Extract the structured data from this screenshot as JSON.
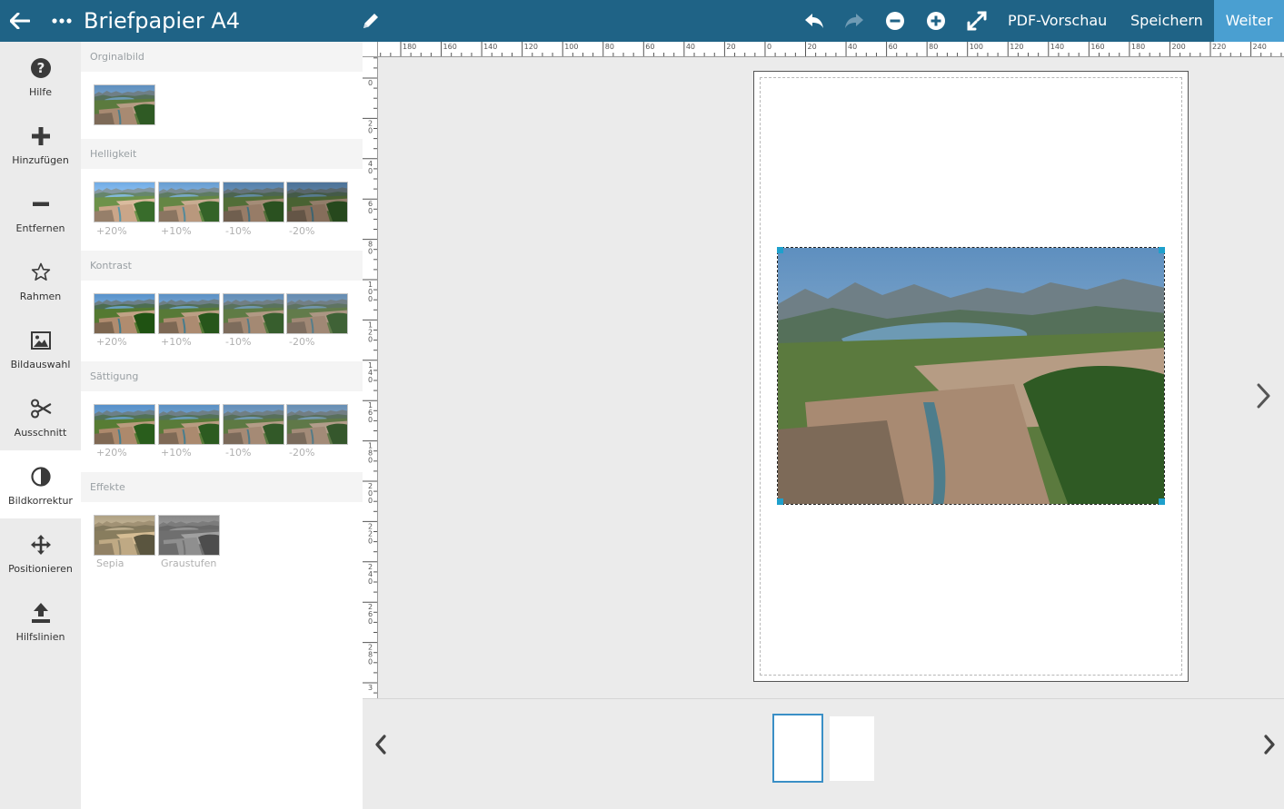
{
  "header": {
    "title": "Briefpapier A4",
    "pdf_preview_label": "PDF-Vorschau",
    "save_label": "Speichern",
    "next_label": "Weiter",
    "icons": [
      "arrow-left-icon",
      "more-icon",
      "pencil-icon",
      "undo-icon",
      "redo-icon",
      "zoom-out-icon",
      "zoom-in-icon",
      "expand-icon"
    ],
    "bar_color": "#1f6386",
    "accent_color": "#4a9fd1"
  },
  "sidebar": {
    "items": [
      {
        "label": "Hilfe",
        "icon": "help-icon"
      },
      {
        "label": "Hinzufügen",
        "icon": "plus-icon"
      },
      {
        "label": "Entfernen",
        "icon": "minus-icon"
      },
      {
        "label": "Rahmen",
        "icon": "star-icon"
      },
      {
        "label": "Bildauswahl",
        "icon": "image-icon"
      },
      {
        "label": "Ausschnitt",
        "icon": "scissors-icon"
      },
      {
        "label": "Bildkorrektur",
        "icon": "contrast-icon",
        "active": true
      },
      {
        "label": "Positionieren",
        "icon": "move-icon"
      },
      {
        "label": "Hilfslinien",
        "icon": "upload-icon"
      }
    ]
  },
  "panel": {
    "original": {
      "title": "Orginalbild"
    },
    "brightness": {
      "title": "Helligkeit",
      "options": [
        "+20%",
        "+10%",
        "-10%",
        "-20%"
      ]
    },
    "contrast": {
      "title": "Kontrast",
      "options": [
        "+20%",
        "+10%",
        "-10%",
        "-20%"
      ]
    },
    "saturation": {
      "title": "Sättigung",
      "options": [
        "+20%",
        "+10%",
        "-10%",
        "-20%"
      ]
    },
    "effects": {
      "title": "Effekte",
      "options": [
        "Sepia",
        "Graustufen"
      ]
    }
  },
  "rulers": {
    "top_labels": [
      "180",
      "160",
      "140",
      "120",
      "100",
      "80",
      "60",
      "40",
      "20",
      "0",
      "20",
      "40",
      "60",
      "80",
      "100",
      "120",
      "140",
      "160",
      "180",
      "200",
      "220",
      "240"
    ],
    "left_labels": [
      "0",
      "20",
      "40",
      "60",
      "80",
      "100",
      "120",
      "140",
      "160",
      "180",
      "200",
      "220",
      "240",
      "260",
      "280",
      "3"
    ]
  },
  "pages": {
    "count": 2,
    "active_index": 0
  }
}
